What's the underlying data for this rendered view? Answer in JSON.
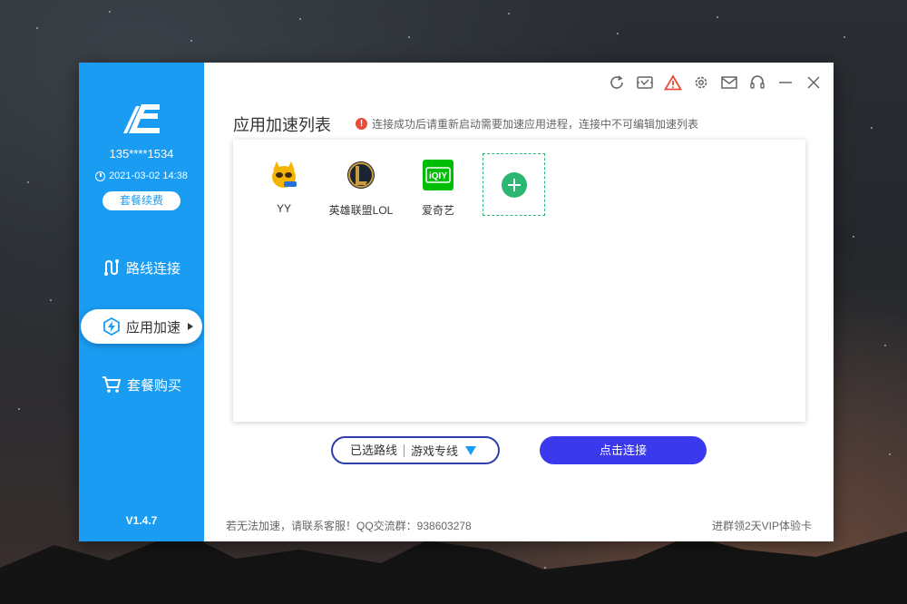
{
  "sidebar": {
    "account": "135****1534",
    "expire": "2021-03-02 14:38",
    "renew_label": "套餐续费",
    "nav": [
      {
        "label": "路线连接",
        "icon": "route-icon"
      },
      {
        "label": "应用加速",
        "icon": "lightning-icon"
      },
      {
        "label": "套餐购买",
        "icon": "cart-icon"
      }
    ],
    "version": "V1.4.7"
  },
  "titlebar": {
    "buttons": [
      "refresh-icon",
      "ticket-icon",
      "warning-icon",
      "gear-icon",
      "mail-icon",
      "headset-icon",
      "minimize-icon",
      "close-icon"
    ]
  },
  "main": {
    "title": "应用加速列表",
    "notice": "连接成功后请重新启动需要加速应用进程，连接中不可编辑加速列表",
    "apps": [
      {
        "name": "YY",
        "icon": "yy-icon"
      },
      {
        "name": "英雄联盟LOL",
        "icon": "lol-icon"
      },
      {
        "name": "爱奇艺",
        "icon": "iqiyi-icon"
      }
    ],
    "iqiyi_logo_text": "iQIY"
  },
  "route": {
    "label": "已选路线",
    "value": "游戏专线"
  },
  "connect_label": "点击连接",
  "footer": {
    "left": "若无法加速，请联系客服！QQ交流群：938603278",
    "right": "进群领2天VIP体验卡"
  },
  "colors": {
    "sidebar": "#1a9cf3",
    "connect": "#3b39ee",
    "add": "#2bb673",
    "warning": "#e74c3c"
  }
}
